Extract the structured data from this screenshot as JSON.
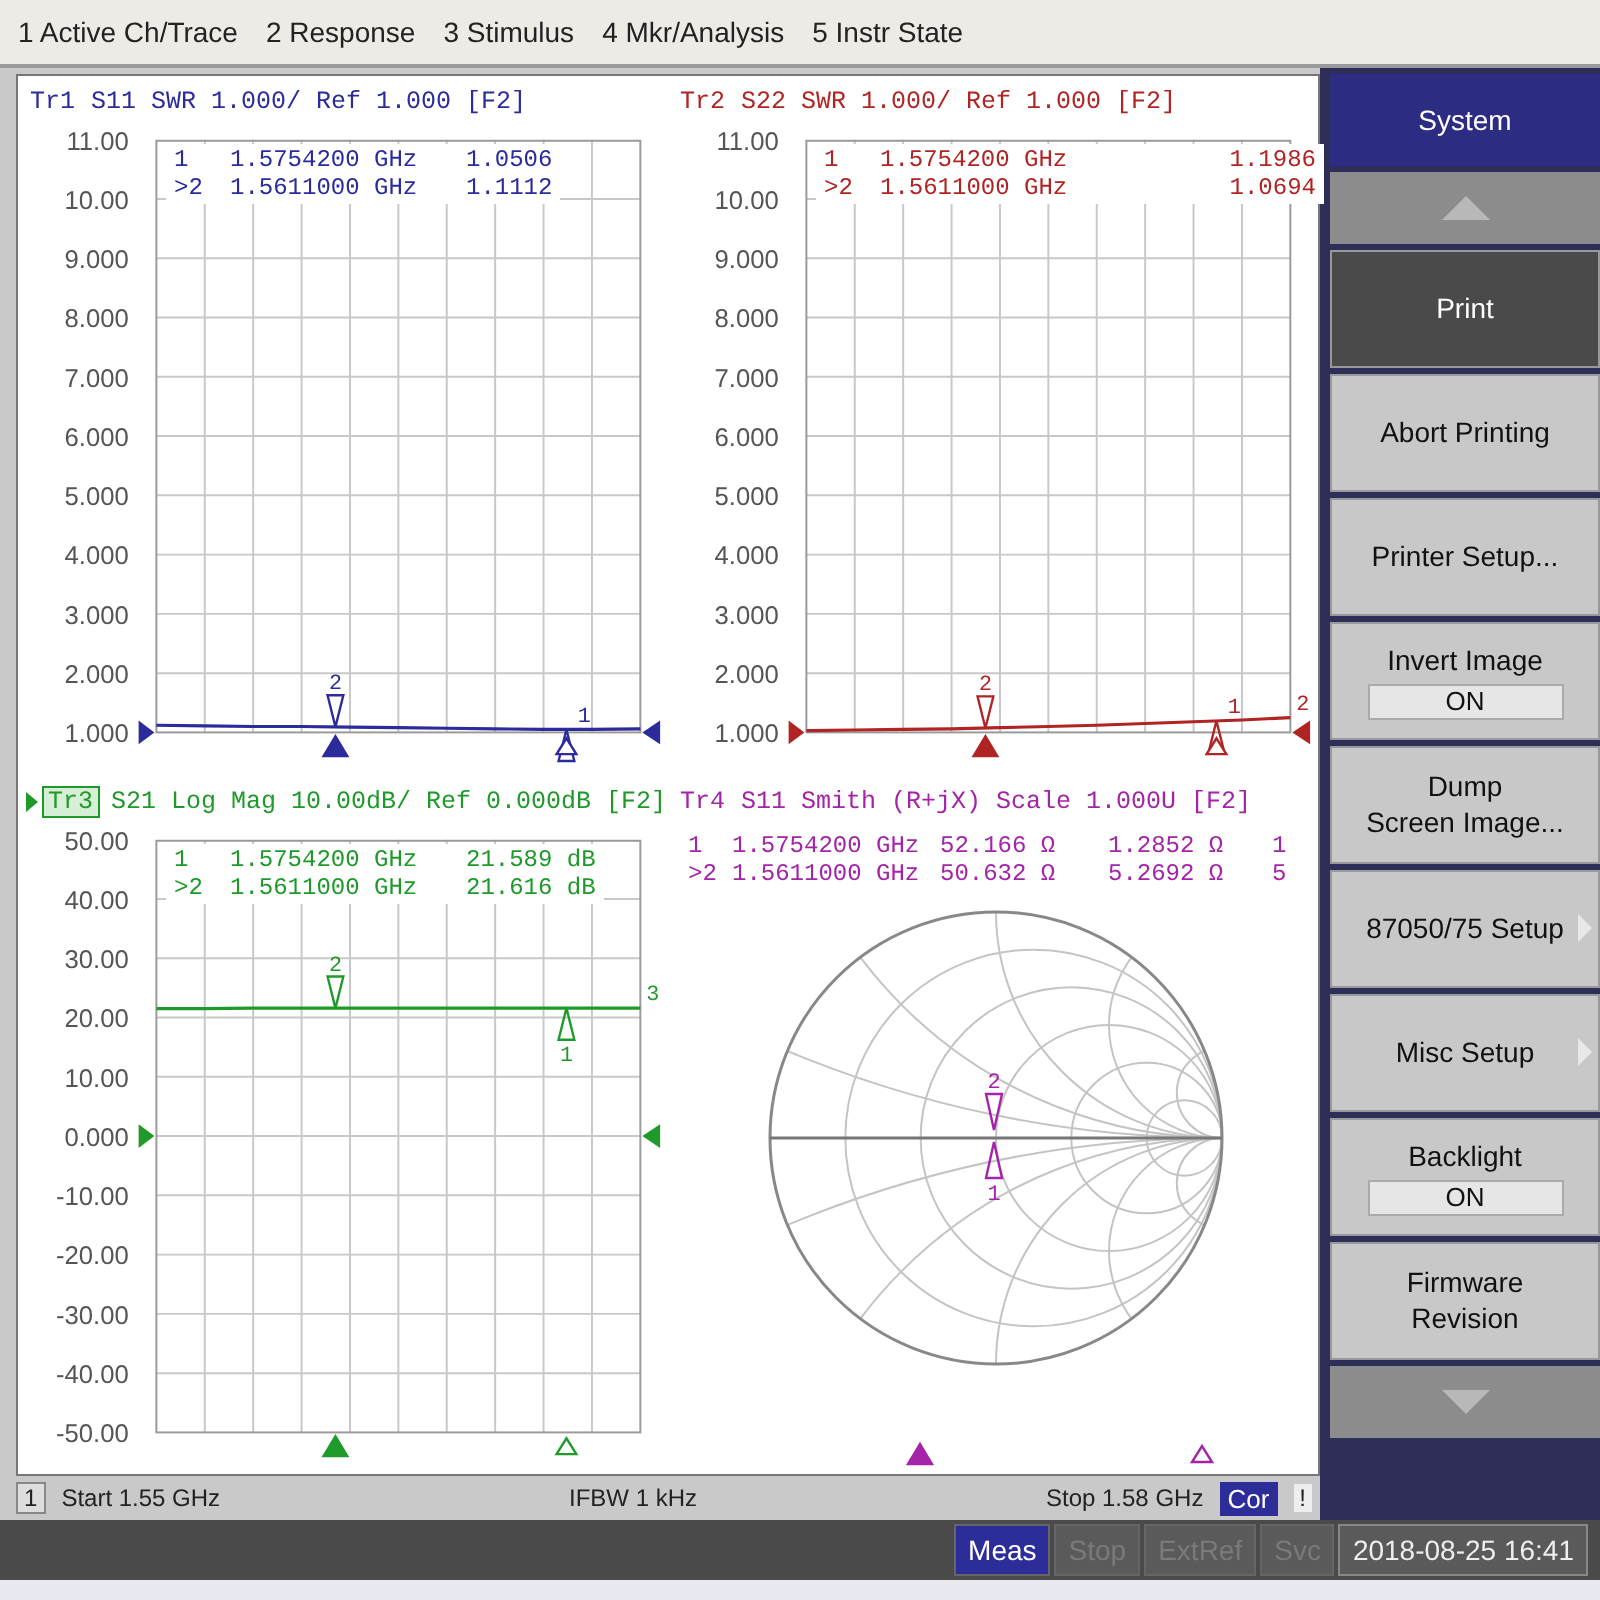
{
  "menu": [
    {
      "label": "1 Active Ch/Trace"
    },
    {
      "label": "2 Response"
    },
    {
      "label": "3 Stimulus"
    },
    {
      "label": "4 Mkr/Analysis"
    },
    {
      "label": "5 Instr State"
    }
  ],
  "plots": [
    {
      "title": {
        "text": "S11 SWR 1.000/ Ref 1.000 [F2]",
        "selected": false
      },
      "reference": {
        "level": 0
      },
      "readouts": [
        {
          "marker": "1",
          "label": "1",
          "frequency": "1.5754200 GHz",
          "value": "1.0506",
          "active": false
        },
        {
          "marker": ">2",
          "label": "2",
          "frequency": "1.5611000 GHz",
          "value": "1.1112",
          "active": true
        }
      ],
      "chart_data": {
        "type": "line",
        "categories": [
          null,
          null,
          null,
          null,
          null,
          null,
          null,
          null,
          null,
          null,
          null
        ],
        "ylim": [
          1,
          11
        ],
        "yticks": [
          {
            "value": 11,
            "label": "11.00"
          },
          {
            "value": 10,
            "label": "10.00"
          },
          {
            "value": 9,
            "label": "9.000"
          },
          {
            "value": 8,
            "label": "8.000"
          },
          {
            "value": 7,
            "label": "7.000"
          },
          {
            "value": 6,
            "label": "6.000"
          },
          {
            "value": 5,
            "label": "5.000"
          },
          {
            "value": 4,
            "label": "4.000"
          },
          {
            "value": 3,
            "label": "3.000"
          },
          {
            "value": 2,
            "label": "2.000"
          },
          {
            "value": 1,
            "label": "1.000"
          }
        ],
        "grid": true,
        "series": [
          {
            "name": "Tr1",
            "color": "#2b2b9c",
            "values": [
              1.12,
              1.11,
              1.1,
              1.1,
              1.09,
              1.08,
              1.07,
              1.06,
              1.05,
              1.05,
              1.06
            ]
          }
        ]
      }
    },
    {
      "title": {
        "text": "S22 SWR 1.000/ Ref 1.000 [F2]",
        "selected": false
      },
      "reference": {
        "level": 0
      },
      "end_label": "2",
      "readouts": [
        {
          "marker": "1",
          "label": "1",
          "frequency": "1.5754200 GHz",
          "value": "1.1986",
          "active": false
        },
        {
          "marker": ">2",
          "label": "2",
          "frequency": "1.5611000 GHz",
          "value": "1.0694",
          "active": true
        }
      ],
      "chart_data": {
        "type": "line",
        "categories": [
          null,
          null,
          null,
          null,
          null,
          null,
          null,
          null,
          null,
          null,
          null
        ],
        "ylim": [
          1,
          11
        ],
        "yticks": [
          {
            "value": 11,
            "label": "11.00"
          },
          {
            "value": 10,
            "label": "10.00"
          },
          {
            "value": 9,
            "label": "9.000"
          },
          {
            "value": 8,
            "label": "8.000"
          },
          {
            "value": 7,
            "label": "7.000"
          },
          {
            "value": 6,
            "label": "6.000"
          },
          {
            "value": 5,
            "label": "5.000"
          },
          {
            "value": 4,
            "label": "4.000"
          },
          {
            "value": 3,
            "label": "3.000"
          },
          {
            "value": 2,
            "label": "2.000"
          },
          {
            "value": 1,
            "label": "1.000"
          }
        ],
        "grid": true,
        "series": [
          {
            "name": "Tr2",
            "color": "#b02424",
            "values": [
              1.03,
              1.04,
              1.05,
              1.06,
              1.08,
              1.1,
              1.12,
              1.15,
              1.18,
              1.21,
              1.25
            ]
          }
        ]
      }
    },
    {
      "title": {
        "text": "S21 Log Mag 10.00dB/ Ref 0.000dB [F2]",
        "selected": true
      },
      "reference": {
        "level": 0.5
      },
      "end_label": "3",
      "readouts": [
        {
          "marker": "1",
          "label": "1",
          "frequency": "1.5754200 GHz",
          "value": "21.589 dB",
          "active": false
        },
        {
          "marker": ">2",
          "label": "2",
          "frequency": "1.5611000 GHz",
          "value": "21.616 dB",
          "active": true
        }
      ],
      "chart_data": {
        "type": "line",
        "categories": [
          null,
          null,
          null,
          null,
          null,
          null,
          null,
          null,
          null,
          null,
          null
        ],
        "ylim": [
          -50,
          50
        ],
        "yticks": [
          {
            "value": 50,
            "label": "50.00"
          },
          {
            "value": 40,
            "label": "40.00"
          },
          {
            "value": 30,
            "label": "30.00"
          },
          {
            "value": 20,
            "label": "20.00"
          },
          {
            "value": 10,
            "label": "10.00"
          },
          {
            "value": 0,
            "label": "0.000"
          },
          {
            "value": -10,
            "label": "-10.00"
          },
          {
            "value": -20,
            "label": "-20.00"
          },
          {
            "value": -30,
            "label": "-30.00"
          },
          {
            "value": -40,
            "label": "-40.00"
          },
          {
            "value": -50,
            "label": "-50.00"
          }
        ],
        "grid": true,
        "series": [
          {
            "name": "Tr3",
            "color": "#1f9a2a",
            "values": [
              21.5,
              21.5,
              21.6,
              21.6,
              21.6,
              21.6,
              21.6,
              21.6,
              21.6,
              21.6,
              21.6
            ]
          }
        ]
      }
    }
  ],
  "smith": {
    "title": {
      "trace": "Tr4",
      "text": "S11 Smith (R+jX) Scale 1.000U [F2]",
      "selected": false
    },
    "color": "#a424a8",
    "readouts": [
      {
        "marker": "1",
        "frequency": "1.5754200 GHz",
        "resistance": "52.166 Ω",
        "reactance": "1.2852 Ω",
        "column_5": "1"
      },
      {
        "marker": ">2",
        "frequency": "1.5611000 GHz",
        "resistance": "50.632 Ω",
        "reactance": "5.2692 Ω",
        "column_5": "5"
      }
    ],
    "markers": [
      {
        "label": "2",
        "active": true
      },
      {
        "label": "1",
        "active": false
      }
    ]
  },
  "channel_bar": {
    "channel": "1",
    "start": "Start 1.55 GHz",
    "ifbw": "IFBW 1 kHz",
    "stop": "Stop 1.58 GHz",
    "correction": {
      "label": "Cor",
      "on": true
    },
    "warning": "!"
  },
  "softkeys": [
    {
      "kind": "title",
      "label": "System"
    },
    {
      "kind": "scroll_up"
    },
    {
      "kind": "button",
      "label": "Print",
      "selected": true
    },
    {
      "kind": "button",
      "label": "Abort Printing",
      "selected": false
    },
    {
      "kind": "button",
      "label": "Printer Setup...",
      "selected": false
    },
    {
      "kind": "toggle",
      "label": "Invert Image",
      "value": "ON"
    },
    {
      "kind": "button",
      "label": "Dump\nScreen Image...",
      "selected": false
    },
    {
      "kind": "submenu",
      "label": "87050/75 Setup"
    },
    {
      "kind": "submenu",
      "label": "Misc Setup"
    },
    {
      "kind": "toggle",
      "label": "Backlight",
      "value": "ON"
    },
    {
      "kind": "button",
      "label": "Firmware\nRevision",
      "selected": false
    },
    {
      "kind": "scroll_down"
    }
  ],
  "status_bar": {
    "indicators": [
      {
        "label": "Meas",
        "on": true
      },
      {
        "label": "Stop",
        "on": false
      },
      {
        "label": "ExtRef",
        "on": false
      },
      {
        "label": "Svc",
        "on": false
      }
    ],
    "datetime": "2018-08-25 16:41"
  }
}
